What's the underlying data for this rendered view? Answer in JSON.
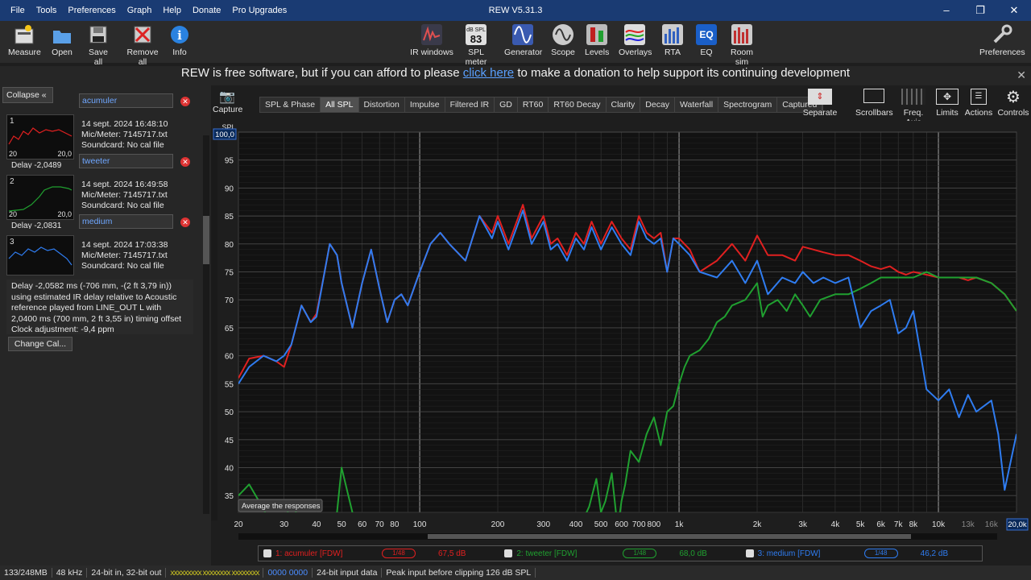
{
  "app": {
    "title": "REW V5.31.3",
    "menus": [
      "File",
      "Tools",
      "Preferences",
      "Graph",
      "Help",
      "Donate",
      "Pro Upgrades"
    ]
  },
  "toolbar": {
    "left": [
      "Measure",
      "Open",
      "Save all",
      "Remove all",
      "Info"
    ],
    "center": [
      "IR windows",
      "SPL meter",
      "Generator",
      "Scope",
      "Levels",
      "Overlays",
      "RTA",
      "EQ",
      "Room sim"
    ],
    "spl_icon_label": "dB SPL",
    "spl_icon_value": "83",
    "right": [
      "Preferences"
    ]
  },
  "donation": {
    "before": "REW is free software, but if you can afford to please ",
    "link": "click here",
    "after": " to make a donation to help support its continuing development"
  },
  "left_panel": {
    "collapse_label": "Collapse",
    "measurements": [
      {
        "index": "1",
        "name": "acumuler",
        "date": "14 sept. 2024 16:48:10",
        "mic": "Mic/Meter: 7145717.txt",
        "soundcard": "Soundcard: No cal file",
        "delay": "Delay -2,0489",
        "color": "#e02020",
        "thumb_left": "20",
        "thumb_right": "20,0"
      },
      {
        "index": "2",
        "name": "tweeter",
        "date": "14 sept. 2024 16:49:58",
        "mic": "Mic/Meter: 7145717.txt",
        "soundcard": "Soundcard: No cal file",
        "delay": "Delay -2,0831",
        "color": "#20a030",
        "thumb_left": "20",
        "thumb_right": "20,0"
      },
      {
        "index": "3",
        "name": "medium",
        "date": "14 sept. 2024 17:03:38",
        "mic": "Mic/Meter: 7145717.txt",
        "soundcard": "Soundcard: No cal file",
        "delay": "",
        "color": "#2f7cf0",
        "thumb_left": "",
        "thumb_right": ""
      }
    ],
    "description": "Delay -2,0582 ms (-706 mm, -(2 ft 3,79 in)) using estimated IR delay relative to Acoustic reference played from LINE_OUT L with 2,0400 ms (700 mm, 2 ft 3,55 in) timing offset Clock adjustment: -9,4 ppm",
    "change_cal": "Change Cal..."
  },
  "graph": {
    "capture_label": "Capture",
    "tabs": [
      "SPL & Phase",
      "All SPL",
      "Distortion",
      "Impulse",
      "Filtered IR",
      "GD",
      "RT60",
      "RT60 Decay",
      "Clarity",
      "Decay",
      "Waterfall",
      "Spectrogram",
      "Captured"
    ],
    "active_tab": "All SPL",
    "right_buttons": [
      "Separate",
      "Scrollbars",
      "Freq. Axis",
      "Limits",
      "Actions",
      "Controls"
    ],
    "tooltip": "Average the responses",
    "y_axis_title": "SPL",
    "y_top_value": "100,0",
    "x_right_value": "20,0k"
  },
  "chart_data": {
    "type": "line",
    "x_scale": "log",
    "xlim": [
      20,
      20000
    ],
    "ylim": [
      32,
      100
    ],
    "ylabel": "SPL",
    "x_ticks": [
      "20",
      "30",
      "40",
      "50",
      "60",
      "70",
      "80",
      "100",
      "200",
      "300",
      "400",
      "500",
      "600",
      "700",
      "800",
      "1k",
      "2k",
      "3k",
      "4k",
      "5k",
      "6k",
      "7k",
      "8k",
      "10k",
      "13k",
      "16k",
      "20,0k"
    ],
    "y_ticks": [
      35,
      40,
      45,
      50,
      55,
      60,
      65,
      70,
      75,
      80,
      85,
      90,
      95,
      100
    ],
    "grid": true,
    "series": [
      {
        "name": "1: acumuler [FDW]",
        "color": "#e02020",
        "smoothing": "1/48",
        "level": "67,5 dB",
        "x": [
          20,
          22,
          25,
          28,
          30,
          32,
          35,
          38,
          40,
          43,
          45,
          48,
          50,
          55,
          60,
          65,
          70,
          75,
          80,
          85,
          90,
          100,
          110,
          120,
          130,
          150,
          170,
          190,
          200,
          220,
          250,
          270,
          300,
          320,
          340,
          370,
          400,
          430,
          460,
          500,
          550,
          600,
          650,
          700,
          750,
          800,
          850,
          900,
          950,
          1000,
          1100,
          1200,
          1400,
          1600,
          1800,
          2000,
          2200,
          2500,
          2800,
          3000,
          3300,
          3600,
          4000,
          4500,
          5000,
          5500,
          6000,
          6500,
          7000,
          7500,
          8000,
          9000,
          10000,
          11000,
          12000,
          13000,
          14000,
          16000,
          18000,
          20000
        ],
        "y": [
          56,
          59.5,
          60,
          59,
          58,
          62,
          69,
          66,
          67.5,
          75,
          80,
          78,
          73,
          65,
          73,
          79,
          72,
          66,
          70,
          71,
          69,
          75,
          80,
          82,
          80,
          77,
          85,
          82,
          85,
          80,
          87,
          81,
          85,
          80,
          81,
          78,
          82,
          80,
          84,
          80,
          84,
          81,
          79,
          85,
          82,
          81,
          82,
          75,
          81,
          81,
          79,
          75,
          77,
          80,
          77,
          81.5,
          78,
          78,
          77,
          79.5,
          79,
          78.5,
          78,
          78,
          77,
          76,
          75.5,
          76,
          75,
          74.5,
          75,
          74.5,
          74,
          74,
          74,
          73.5,
          74,
          73,
          71,
          68
        ]
      },
      {
        "name": "2: tweeter [FDW]",
        "color": "#20a030",
        "smoothing": "1/48",
        "level": "68,0 dB",
        "x": [
          20,
          21,
          22,
          24,
          26,
          28,
          30,
          32,
          34,
          36,
          40,
          45,
          48,
          50,
          55,
          60,
          65,
          70,
          80,
          100,
          150,
          200,
          300,
          400,
          420,
          450,
          480,
          500,
          520,
          550,
          580,
          600,
          620,
          650,
          700,
          750,
          800,
          850,
          900,
          950,
          1000,
          1050,
          1100,
          1200,
          1300,
          1400,
          1500,
          1600,
          1800,
          2000,
          2100,
          2200,
          2400,
          2600,
          2800,
          3000,
          3200,
          3500,
          4000,
          4500,
          5000,
          5500,
          6000,
          7000,
          8000,
          9000,
          10000,
          12000,
          14000,
          16000,
          18000,
          20000
        ],
        "y": [
          35,
          36,
          37,
          34,
          31,
          27,
          30,
          34,
          31,
          29,
          24,
          26,
          32,
          40,
          32,
          25,
          27,
          24,
          24,
          25,
          25,
          25,
          24,
          28,
          30,
          33,
          38,
          32,
          34,
          39,
          29,
          34,
          37,
          43,
          41,
          46,
          49,
          44,
          50,
          51,
          55,
          58,
          60,
          61,
          63,
          66,
          67,
          69,
          70,
          73,
          67,
          69,
          70,
          68,
          71,
          69,
          67,
          70,
          71,
          71,
          72,
          73,
          74,
          74,
          74,
          75,
          74,
          74,
          74,
          73,
          71,
          68
        ]
      },
      {
        "name": "3: medium [FDW]",
        "color": "#2f7cf0",
        "smoothing": "1/48",
        "level": "46,2 dB",
        "x": [
          20,
          22,
          25,
          28,
          30,
          32,
          35,
          38,
          40,
          43,
          45,
          48,
          50,
          55,
          60,
          65,
          70,
          75,
          80,
          85,
          90,
          100,
          110,
          120,
          130,
          150,
          170,
          190,
          200,
          220,
          250,
          270,
          300,
          320,
          340,
          370,
          400,
          430,
          460,
          500,
          550,
          600,
          650,
          700,
          750,
          800,
          850,
          900,
          950,
          1000,
          1100,
          1200,
          1400,
          1600,
          1800,
          2000,
          2200,
          2500,
          2800,
          3000,
          3300,
          3600,
          4000,
          4500,
          5000,
          5500,
          6000,
          6500,
          7000,
          7500,
          8000,
          9000,
          10000,
          11000,
          12000,
          13000,
          14000,
          16000,
          17000,
          18000,
          20000
        ],
        "y": [
          55,
          58,
          60,
          59,
          60,
          62,
          69,
          66,
          67,
          75,
          80,
          78,
          73,
          65,
          73,
          79,
          72,
          66,
          70,
          71,
          69,
          75,
          80,
          82,
          80,
          77,
          85,
          81,
          84,
          79,
          86,
          80,
          84,
          79,
          80,
          77,
          81,
          79,
          83,
          79,
          83,
          80,
          78,
          84,
          81,
          80,
          81,
          75,
          81,
          80,
          78,
          75,
          74,
          77,
          73,
          77,
          71,
          74,
          73,
          75,
          73,
          74,
          73,
          74,
          65,
          68,
          69,
          70,
          64,
          65,
          68,
          54,
          52,
          54,
          49,
          53,
          50,
          52,
          46,
          36,
          46
        ]
      }
    ]
  },
  "legend": [
    {
      "label": "1: acumuler [FDW]",
      "smoothing": "1/48",
      "value": "67,5 dB",
      "color": "#e02020"
    },
    {
      "label": "2: tweeter [FDW]",
      "smoothing": "1/48",
      "value": "68,0 dB",
      "color": "#20a030"
    },
    {
      "label": "3: medium [FDW]",
      "smoothing": "1/48",
      "value": "46,2 dB",
      "color": "#2f7cf0"
    }
  ],
  "status": [
    "133/248MB",
    "48 kHz",
    "24-bit in, 32-bit out",
    "0000 0000",
    "24-bit input data",
    "Peak input before clipping 126 dB SPL"
  ]
}
